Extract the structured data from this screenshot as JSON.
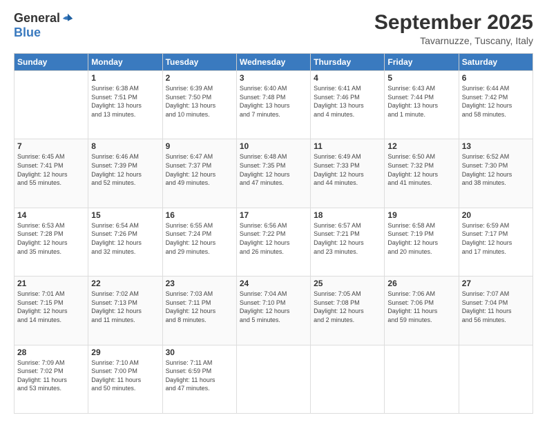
{
  "logo": {
    "general": "General",
    "blue": "Blue"
  },
  "header": {
    "month": "September 2025",
    "location": "Tavarnuzze, Tuscany, Italy"
  },
  "days": [
    "Sunday",
    "Monday",
    "Tuesday",
    "Wednesday",
    "Thursday",
    "Friday",
    "Saturday"
  ],
  "weeks": [
    [
      {
        "day": "",
        "info": ""
      },
      {
        "day": "1",
        "info": "Sunrise: 6:38 AM\nSunset: 7:51 PM\nDaylight: 13 hours\nand 13 minutes."
      },
      {
        "day": "2",
        "info": "Sunrise: 6:39 AM\nSunset: 7:50 PM\nDaylight: 13 hours\nand 10 minutes."
      },
      {
        "day": "3",
        "info": "Sunrise: 6:40 AM\nSunset: 7:48 PM\nDaylight: 13 hours\nand 7 minutes."
      },
      {
        "day": "4",
        "info": "Sunrise: 6:41 AM\nSunset: 7:46 PM\nDaylight: 13 hours\nand 4 minutes."
      },
      {
        "day": "5",
        "info": "Sunrise: 6:43 AM\nSunset: 7:44 PM\nDaylight: 13 hours\nand 1 minute."
      },
      {
        "day": "6",
        "info": "Sunrise: 6:44 AM\nSunset: 7:42 PM\nDaylight: 12 hours\nand 58 minutes."
      }
    ],
    [
      {
        "day": "7",
        "info": "Sunrise: 6:45 AM\nSunset: 7:41 PM\nDaylight: 12 hours\nand 55 minutes."
      },
      {
        "day": "8",
        "info": "Sunrise: 6:46 AM\nSunset: 7:39 PM\nDaylight: 12 hours\nand 52 minutes."
      },
      {
        "day": "9",
        "info": "Sunrise: 6:47 AM\nSunset: 7:37 PM\nDaylight: 12 hours\nand 49 minutes."
      },
      {
        "day": "10",
        "info": "Sunrise: 6:48 AM\nSunset: 7:35 PM\nDaylight: 12 hours\nand 47 minutes."
      },
      {
        "day": "11",
        "info": "Sunrise: 6:49 AM\nSunset: 7:33 PM\nDaylight: 12 hours\nand 44 minutes."
      },
      {
        "day": "12",
        "info": "Sunrise: 6:50 AM\nSunset: 7:32 PM\nDaylight: 12 hours\nand 41 minutes."
      },
      {
        "day": "13",
        "info": "Sunrise: 6:52 AM\nSunset: 7:30 PM\nDaylight: 12 hours\nand 38 minutes."
      }
    ],
    [
      {
        "day": "14",
        "info": "Sunrise: 6:53 AM\nSunset: 7:28 PM\nDaylight: 12 hours\nand 35 minutes."
      },
      {
        "day": "15",
        "info": "Sunrise: 6:54 AM\nSunset: 7:26 PM\nDaylight: 12 hours\nand 32 minutes."
      },
      {
        "day": "16",
        "info": "Sunrise: 6:55 AM\nSunset: 7:24 PM\nDaylight: 12 hours\nand 29 minutes."
      },
      {
        "day": "17",
        "info": "Sunrise: 6:56 AM\nSunset: 7:22 PM\nDaylight: 12 hours\nand 26 minutes."
      },
      {
        "day": "18",
        "info": "Sunrise: 6:57 AM\nSunset: 7:21 PM\nDaylight: 12 hours\nand 23 minutes."
      },
      {
        "day": "19",
        "info": "Sunrise: 6:58 AM\nSunset: 7:19 PM\nDaylight: 12 hours\nand 20 minutes."
      },
      {
        "day": "20",
        "info": "Sunrise: 6:59 AM\nSunset: 7:17 PM\nDaylight: 12 hours\nand 17 minutes."
      }
    ],
    [
      {
        "day": "21",
        "info": "Sunrise: 7:01 AM\nSunset: 7:15 PM\nDaylight: 12 hours\nand 14 minutes."
      },
      {
        "day": "22",
        "info": "Sunrise: 7:02 AM\nSunset: 7:13 PM\nDaylight: 12 hours\nand 11 minutes."
      },
      {
        "day": "23",
        "info": "Sunrise: 7:03 AM\nSunset: 7:11 PM\nDaylight: 12 hours\nand 8 minutes."
      },
      {
        "day": "24",
        "info": "Sunrise: 7:04 AM\nSunset: 7:10 PM\nDaylight: 12 hours\nand 5 minutes."
      },
      {
        "day": "25",
        "info": "Sunrise: 7:05 AM\nSunset: 7:08 PM\nDaylight: 12 hours\nand 2 minutes."
      },
      {
        "day": "26",
        "info": "Sunrise: 7:06 AM\nSunset: 7:06 PM\nDaylight: 11 hours\nand 59 minutes."
      },
      {
        "day": "27",
        "info": "Sunrise: 7:07 AM\nSunset: 7:04 PM\nDaylight: 11 hours\nand 56 minutes."
      }
    ],
    [
      {
        "day": "28",
        "info": "Sunrise: 7:09 AM\nSunset: 7:02 PM\nDaylight: 11 hours\nand 53 minutes."
      },
      {
        "day": "29",
        "info": "Sunrise: 7:10 AM\nSunset: 7:00 PM\nDaylight: 11 hours\nand 50 minutes."
      },
      {
        "day": "30",
        "info": "Sunrise: 7:11 AM\nSunset: 6:59 PM\nDaylight: 11 hours\nand 47 minutes."
      },
      {
        "day": "",
        "info": ""
      },
      {
        "day": "",
        "info": ""
      },
      {
        "day": "",
        "info": ""
      },
      {
        "day": "",
        "info": ""
      }
    ]
  ]
}
